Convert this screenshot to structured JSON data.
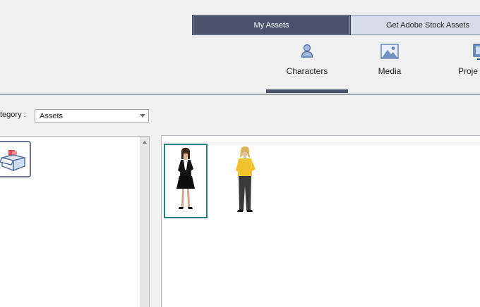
{
  "top_tabs": {
    "my_assets": "My Assets",
    "stock": "Get Adobe Stock Assets"
  },
  "type_tabs": {
    "characters": "Characters",
    "media": "Media",
    "projects": "Proje"
  },
  "category": {
    "label": "tegory :",
    "selected": "Assets"
  },
  "colors": {
    "accent": "#4a536b",
    "selection": "#2f7e78",
    "divider": "#9da2ad"
  },
  "icons": {
    "characters": "person-icon",
    "media": "image-icon",
    "projects": "monitor-icon",
    "category": "box-icon"
  }
}
